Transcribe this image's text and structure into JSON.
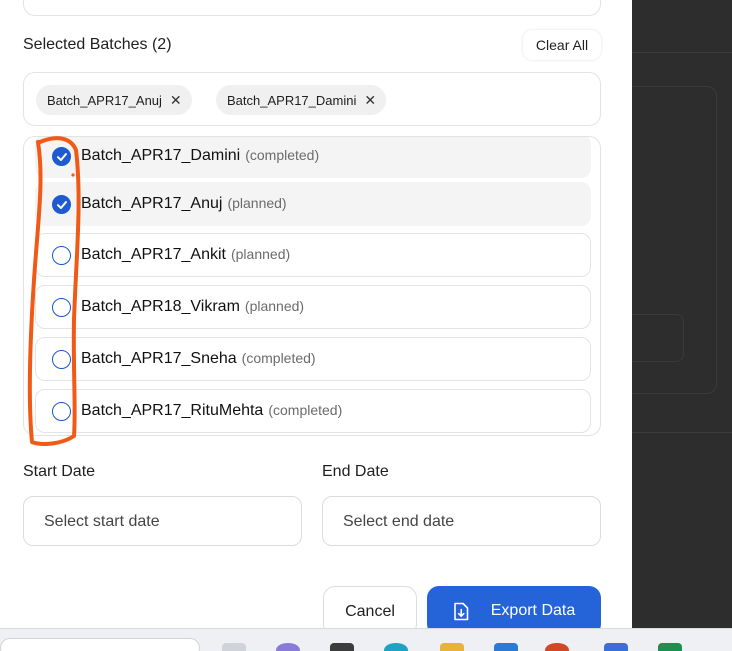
{
  "selected_batches": {
    "title": "Selected Batches (2)",
    "clear_all_label": "Clear All",
    "chips": [
      {
        "label": "Batch_APR17_Anuj"
      },
      {
        "label": "Batch_APR17_Damini"
      }
    ]
  },
  "batch_list": [
    {
      "name": "Batch_APR17_Damini",
      "status": "(completed)",
      "checked": true
    },
    {
      "name": "Batch_APR17_Anuj",
      "status": "(planned)",
      "checked": true
    },
    {
      "name": "Batch_APR17_Ankit",
      "status": "(planned)",
      "checked": false
    },
    {
      "name": "Batch_APR18_Vikram",
      "status": "(planned)",
      "checked": false
    },
    {
      "name": "Batch_APR17_Sneha",
      "status": "(completed)",
      "checked": false
    },
    {
      "name": "Batch_APR17_RituMehta",
      "status": "(completed)",
      "checked": false
    }
  ],
  "dates": {
    "start_label": "Start Date",
    "start_placeholder": "Select start date",
    "end_label": "End Date",
    "end_placeholder": "Select end date"
  },
  "actions": {
    "cancel_label": "Cancel",
    "export_label": "Export Data",
    "export_icon": "file-download-icon"
  },
  "colors": {
    "accent": "#2563d8",
    "annotation": "#f05a16",
    "backdrop": "#2d2d2d"
  },
  "taskbar_icons": [
    "app-icon",
    "app-icon",
    "app-icon",
    "edge-icon",
    "folder-icon",
    "azure-icon",
    "powerpoint-icon",
    "notepad-icon",
    "excel-icon"
  ]
}
